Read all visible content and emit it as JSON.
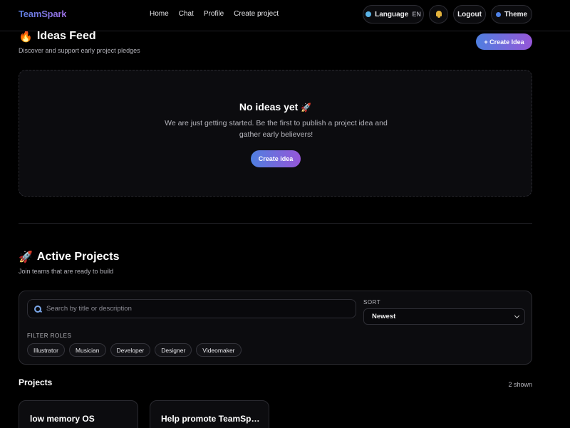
{
  "nav": {
    "brand": "TeamSpark",
    "links": [
      "Home",
      "Chat",
      "Profile",
      "Create project"
    ],
    "language_label": "Language",
    "language_code": "EN",
    "logout_label": "Logout",
    "theme_label": "Theme"
  },
  "ideas": {
    "emoji": "🔥",
    "title": "Ideas Feed",
    "subtitle": "Discover and support early project pledges",
    "create_button": "+ Create Idea",
    "empty_emoji": "🚀",
    "empty_title": "No ideas yet",
    "empty_text": "We are just getting started. Be the first to publish a project idea and gather early believers!",
    "empty_button": "Create idea"
  },
  "projects_section": {
    "emoji": "🚀",
    "title": "Active Projects",
    "subtitle": "Join teams that are ready to build",
    "search_placeholder": "Search by title or description",
    "sort_label": "SORT",
    "sort_value": "Newest",
    "roles_label": "FILTER ROLES",
    "roles": [
      "Illustrator",
      "Musician",
      "Developer",
      "Designer",
      "Videomaker"
    ]
  },
  "projects": {
    "heading": "Projects",
    "count_label": "2 shown",
    "items": [
      {
        "title": "low memory OS"
      },
      {
        "title": "Help promote TeamSpark"
      }
    ]
  },
  "colors": {
    "accent_start": "#4f7fe0",
    "accent_end": "#9656d8",
    "background": "#000000"
  }
}
